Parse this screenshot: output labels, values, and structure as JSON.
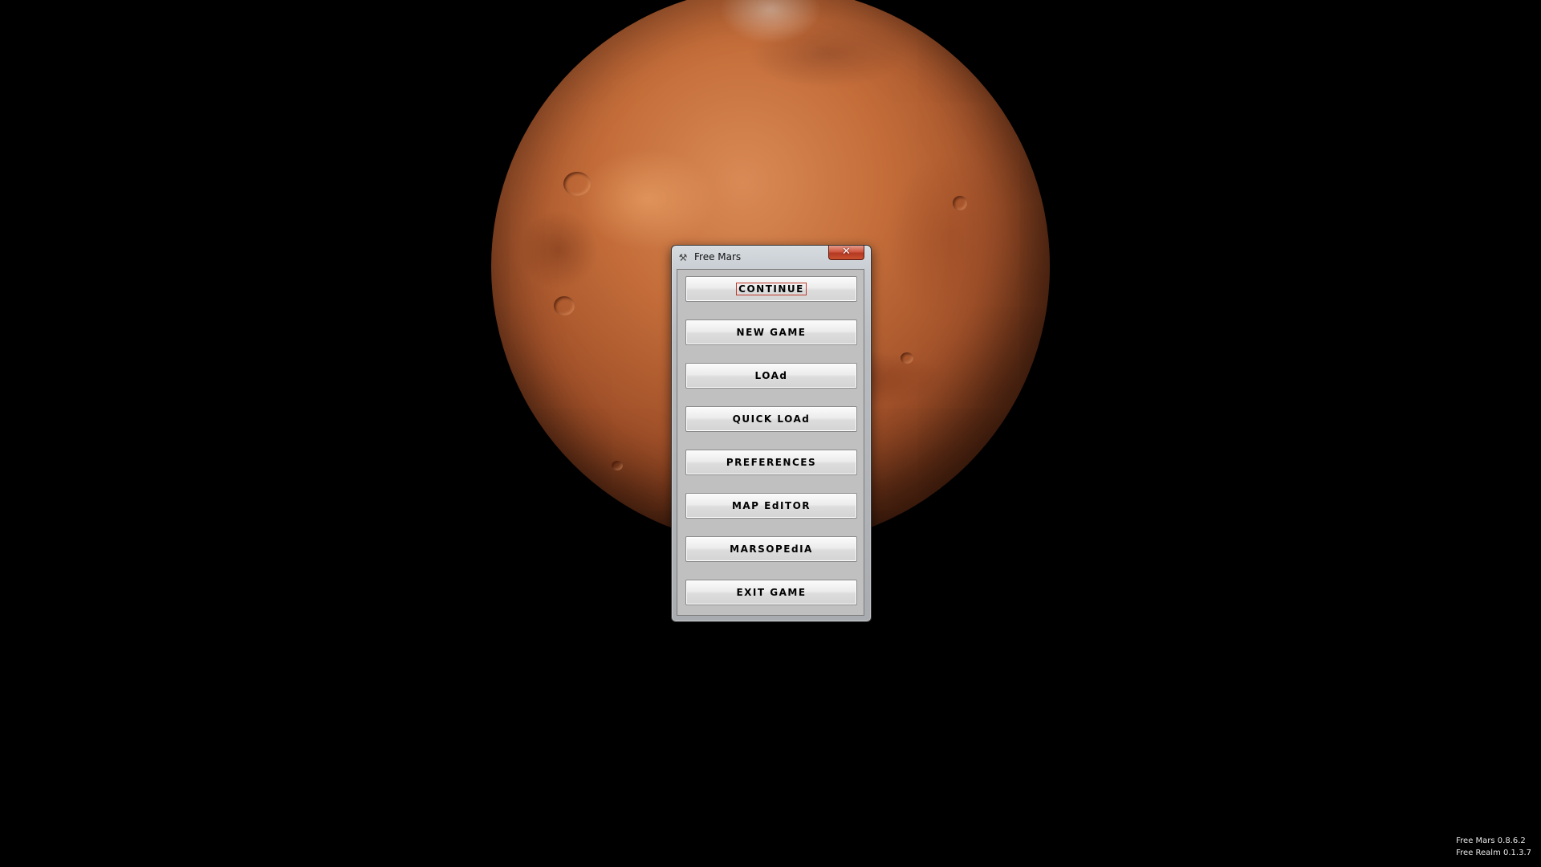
{
  "window": {
    "title": "Free Mars",
    "icon": "wrench-icon",
    "close_glyph": "✕"
  },
  "menu": {
    "focused_item": "Continue",
    "items": [
      {
        "label": "CONTINUE"
      },
      {
        "label": "NEW GAME"
      },
      {
        "label": "LOAd"
      },
      {
        "label": "QUICK LOAd"
      },
      {
        "label": "PREFERENCES"
      },
      {
        "label": "MAP EdITOR"
      },
      {
        "label": "MARSOPEdIA"
      },
      {
        "label": "EXIT GAME"
      }
    ]
  },
  "version_info": {
    "line1": "Free Mars  0.8.6.2",
    "line2": "Free Realm  0.1.3.7"
  },
  "colors": {
    "background": "#000000",
    "planet": "#c46d3a",
    "close_button": "#c9502f",
    "focus_outline": "#c0392b"
  }
}
